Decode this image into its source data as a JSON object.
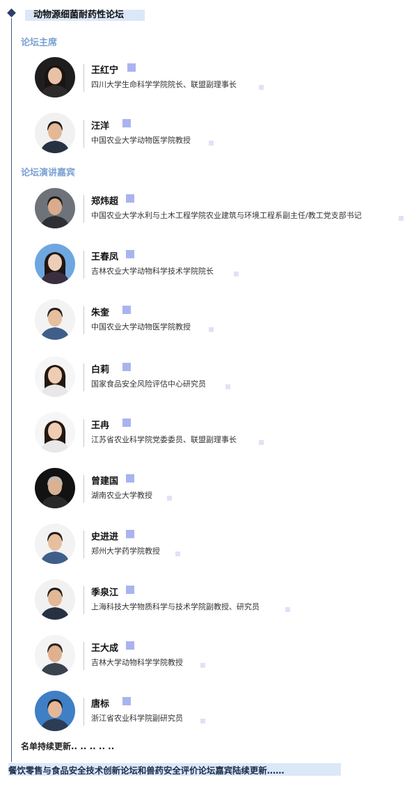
{
  "header": {
    "title": "动物源细菌耐药性论坛"
  },
  "sections": {
    "chair": "论坛主席",
    "speakers": "论坛演讲嘉宾"
  },
  "people": [
    {
      "name": "王红宁",
      "role": "四川大学生命科学学院院长、联盟副理事长",
      "photo": "avatar-woman-dark-bg"
    },
    {
      "name": "汪洋",
      "role": "中国农业大学动物医学院教授",
      "photo": "avatar-man-suit"
    },
    {
      "name": "郑炜超",
      "role": "中国农业大学水利与土木工程学院农业建筑与环境工程系副主任/教工党支部书记",
      "photo": "avatar-man-suit-red-tie"
    },
    {
      "name": "王春凤",
      "role": "吉林农业大学动物科学技术学院院长",
      "photo": "avatar-woman-blue-bg"
    },
    {
      "name": "朱奎",
      "role": "中国农业大学动物医学院教授",
      "photo": "avatar-man-glasses"
    },
    {
      "name": "白莉",
      "role": "国家食品安全风险评估中心研究员",
      "photo": "avatar-woman-white-bg"
    },
    {
      "name": "王冉",
      "role": "江苏省农业科学院党委委员、联盟副理事长",
      "photo": "avatar-woman-white-bg"
    },
    {
      "name": "曾建国",
      "role": "湖南农业大学教授",
      "photo": "avatar-man-dark-bg"
    },
    {
      "name": "史进进",
      "role": "郑州大学药学院教授",
      "photo": "avatar-man-glasses"
    },
    {
      "name": "季泉江",
      "role": "上海科技大学物质科学与技术学院副教授、研究员",
      "photo": "avatar-man-suit"
    },
    {
      "name": "王大成",
      "role": "吉林大学动物科学学院教授",
      "photo": "avatar-man-white-bg"
    },
    {
      "name": "唐标",
      "role": "浙江省农业科学院副研究员",
      "photo": "avatar-man-blue-bg"
    }
  ],
  "footer": {
    "more": "名单持续更新.. .. .. .. ..",
    "banner": "餐饮零售与食品安全技术创新论坛和兽药安全评价论坛嘉宾陆续更新……"
  }
}
